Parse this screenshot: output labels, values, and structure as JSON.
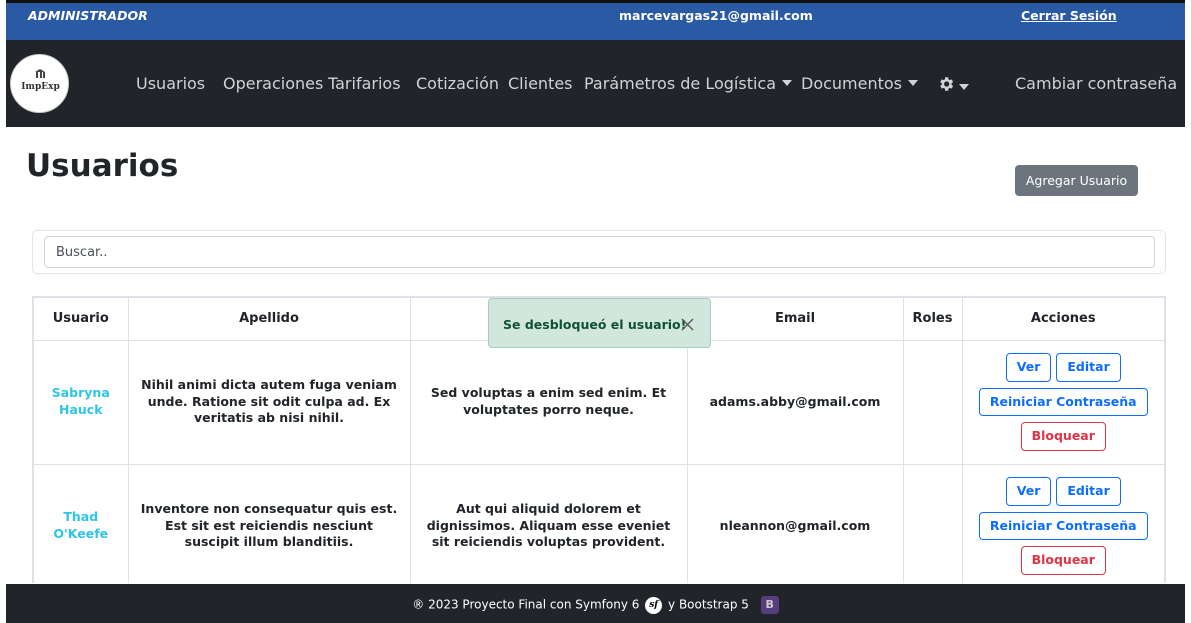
{
  "topbar": {
    "role": "ADMINISTRADOR",
    "email": "marcevargas21@gmail.com",
    "logout": "Cerrar Sesión"
  },
  "navbar": {
    "logo_text": "ImpExp",
    "items": [
      {
        "label": "Usuarios"
      },
      {
        "label": "Operaciones"
      },
      {
        "label": "Tarifarios"
      },
      {
        "label": "Cotización"
      },
      {
        "label": "Clientes"
      },
      {
        "label": "Parámetros de Logística",
        "dropdown": true
      },
      {
        "label": "Documentos",
        "dropdown": true
      }
    ],
    "settings_icon": "gear-icon",
    "change_password": "Cambiar contraseña"
  },
  "page": {
    "title": "Usuarios",
    "add_button": "Agregar Usuario"
  },
  "search": {
    "placeholder": "Buscar.."
  },
  "toast": {
    "message": "Se desbloqueó el usuario!",
    "close_icon": "close-icon"
  },
  "table": {
    "headers": [
      "Usuario",
      "Apellido",
      "",
      "Email",
      "Roles",
      "Acciones"
    ],
    "rows": [
      {
        "usuario": "Sabryna Hauck",
        "apellido": "Nihil animi dicta autem fuga veniam unde. Ratione sit odit culpa ad. Ex veritatis ab nisi nihil.",
        "col3": "Sed voluptas a enim sed enim. Et voluptates porro neque.",
        "email": "adams.abby@gmail.com",
        "roles": ""
      },
      {
        "usuario": "Thad O'Keefe",
        "apellido": "Inventore non consequatur quis est. Est sit est reiciendis nesciunt suscipit illum blanditiis.",
        "col3": "Aut qui aliquid dolorem et dignissimos. Aliquam esse eveniet sit reiciendis voluptas provident.",
        "email": "nleannon@gmail.com",
        "roles": ""
      }
    ],
    "actions": {
      "view": "Ver",
      "edit": "Editar",
      "reset": "Reiniciar Contraseña",
      "block": "Bloquear"
    }
  },
  "footer": {
    "text_before": "® 2023 Proyecto Final con Symfony 6",
    "symfony_logo": "sf",
    "text_after": "y Bootstrap 5",
    "bootstrap_logo": "B"
  },
  "colors": {
    "topbar": "#2b5aa5",
    "navbar": "#212529",
    "link_cyan": "#2dc5e8",
    "primary": "#0d6efd",
    "danger": "#dc3545",
    "toast_bg": "#d1e7dd"
  }
}
